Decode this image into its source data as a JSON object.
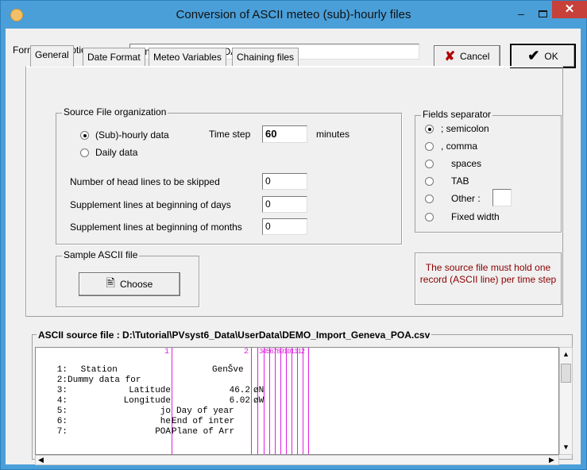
{
  "window": {
    "title": "Conversion of ASCII meteo  (sub)-hourly files",
    "minimize": "‒",
    "close": "✕"
  },
  "header": {
    "format_label": "Format description",
    "format_value": "Demo ASCII import POA",
    "cancel_label": "Cancel",
    "cancel_icon": "✘",
    "ok_label": "OK",
    "ok_icon": "✔"
  },
  "tabs": [
    "General",
    "Date Format",
    "Meteo Variables",
    "Chaining files"
  ],
  "source_org": {
    "title": "Source File organization",
    "opt_subhourly": "(Sub)-hourly data",
    "opt_daily": "Daily data",
    "selected": "subhourly",
    "time_step_label": "Time step",
    "time_step_value": "60",
    "time_step_unit": "minutes",
    "head_lines_label": "Number of head lines to be skipped",
    "head_lines_value": "0",
    "supp_days_label": "Supplement lines at beginning of days",
    "supp_days_value": "0",
    "supp_months_label": "Supplement lines at beginning of months",
    "supp_months_value": "0"
  },
  "sample": {
    "title": "Sample ASCII  file",
    "choose_label": "Choose"
  },
  "separator": {
    "title": "Fields separator",
    "options": [
      ";  semicolon",
      ",   comma",
      "spaces",
      "TAB",
      "Other :",
      "Fixed width"
    ],
    "selected_index": 0,
    "other_value": ""
  },
  "note": "The source file must hold one record (ASCII line) per time step",
  "source_file": {
    "title": "ASCII source file : D:\\Tutorial\\PVsyst6_Data\\UserData\\DEMO_Import_Geneva_POA.csv",
    "ruler_1": "1",
    "ruler_2": "2",
    "ruler_rest": "3456789101112",
    "lines": [
      {
        "num": "1:",
        "c1": " Station",
        "c2": "GenŠve",
        "c3": ""
      },
      {
        "num": "2:",
        "c1": "Dummy data for",
        "c2": "",
        "c3": ""
      },
      {
        "num": "3:",
        "c1": "Latitude",
        "c2": "46.2",
        "c3": "øN"
      },
      {
        "num": "4:",
        "c1": "Longitude",
        "c2": "6.02",
        "c3": "øW"
      },
      {
        "num": "5:",
        "c1": "jo",
        "c2": "Day of year",
        "c3": ""
      },
      {
        "num": "6:",
        "c1": "he",
        "c2": "End of inter",
        "c3": ""
      },
      {
        "num": "7:",
        "c1": "POA",
        "c2": "Plane of Arr",
        "c3": ""
      }
    ]
  }
}
